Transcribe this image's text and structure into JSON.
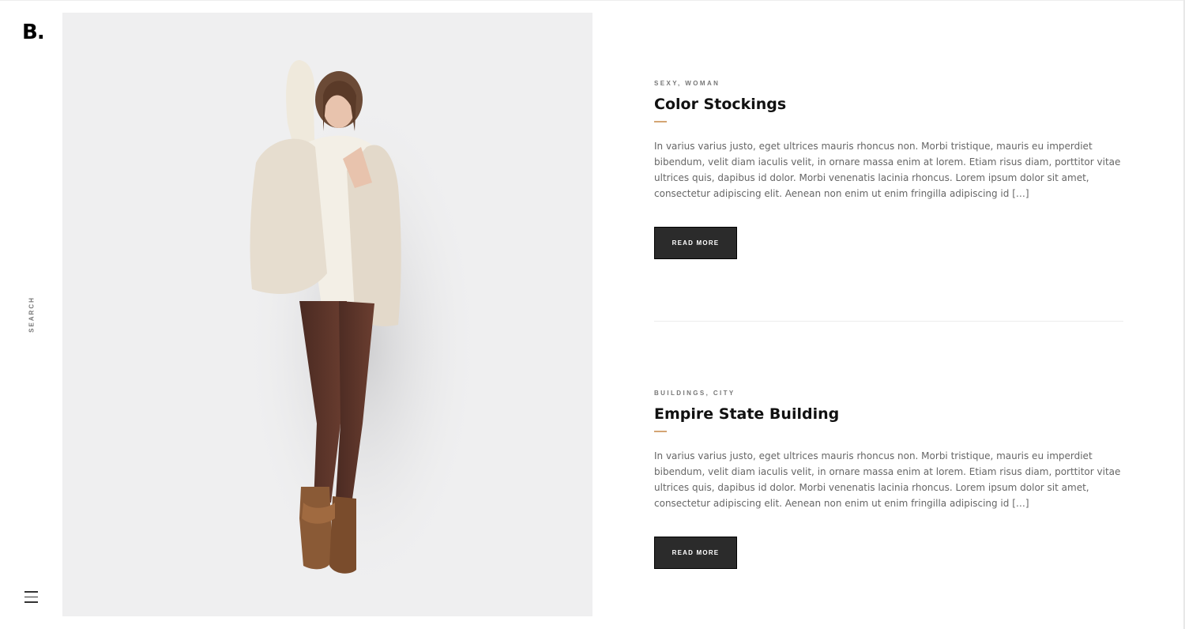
{
  "logo": "B.",
  "sidebar": {
    "search_label": "SEARCH"
  },
  "hero": {
    "image_alt": "Model in fur vest and brown stockings"
  },
  "posts": [
    {
      "categories": "SEXY, WOMAN",
      "title": "Color Stockings",
      "excerpt": "In varius varius justo, eget ultrices mauris rhoncus non. Morbi tristique, mauris eu imperdiet bibendum, velit diam iaculis velit, in ornare massa enim at lorem. Etiam risus diam, porttitor vitae ultrices quis, dapibus id dolor. Morbi venenatis lacinia rhoncus. Lorem ipsum dolor sit amet, consectetur adipiscing elit. Aenean non enim ut enim fringilla adipiscing id […]",
      "button": "READ MORE"
    },
    {
      "categories": "BUILDINGS, CITY",
      "title": "Empire State Building",
      "excerpt": "In varius varius justo, eget ultrices mauris rhoncus non. Morbi tristique, mauris eu imperdiet bibendum, velit diam iaculis velit, in ornare massa enim at lorem. Etiam risus diam, porttitor vitae ultrices quis, dapibus id dolor. Morbi venenatis lacinia rhoncus. Lorem ipsum dolor sit amet, consectetur adipiscing elit. Aenean non enim ut enim fringilla adipiscing id […]",
      "button": "READ MORE"
    }
  ],
  "colors": {
    "accent": "#d4a574",
    "button_bg": "#2b2b2b",
    "text_muted": "#666666"
  },
  "icons": {
    "menu": "hamburger-icon"
  }
}
